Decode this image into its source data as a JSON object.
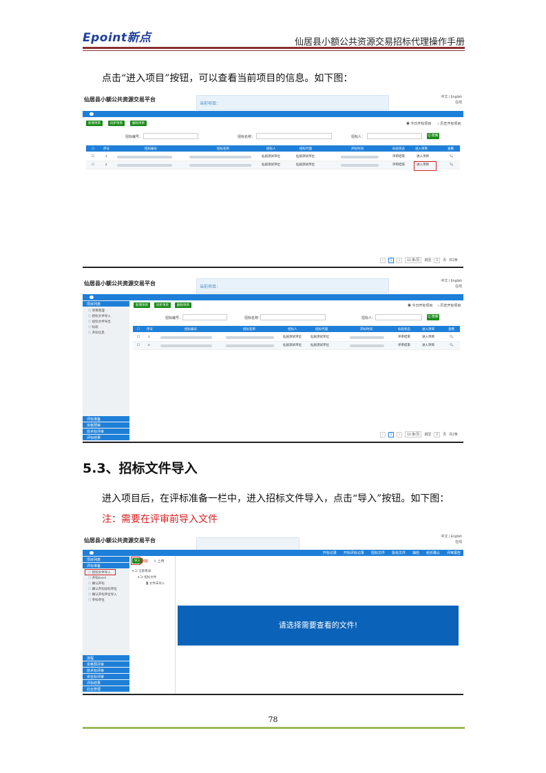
{
  "header": {
    "logo": "Epoint新点",
    "manual_title": "仙居县小额公共资源交易招标代理操作手册"
  },
  "para1": "点击“进入项目”按钮，可以查看当前项目的信息。如下图：",
  "section": {
    "title": "5.3、招标文件导入"
  },
  "para2": "进入项目后，在评标准备一栏中，进入招标文件导入，点击“导入”按钮。如下图：",
  "note": "注：需要在评审前导入文件",
  "page_number": "78",
  "app": {
    "title": "仙居县小额公共资源交易平台",
    "lang": "中文 | English",
    "status": "在线",
    "current_item_label": "当前项目：",
    "btn_new_project": "新增项目",
    "btn_multi_project": "同步项目",
    "btn_delete_project": "删除项目",
    "radio_today": "今日开标项目",
    "radio_all": "历史开标项目",
    "search_code_label": "招标编号：",
    "search_name_label": "招标名称：",
    "search_owner_label": "招标人：",
    "search_btn": "Q 搜索",
    "cols": [
      "序号",
      "招标编号",
      "招标名称",
      "招标人",
      "招标代理",
      "开标时间",
      "标段状态",
      "进入项目",
      "查看"
    ],
    "rows": [
      {
        "num": "1",
        "owner": "仙居测试单位",
        "agent": "仙居测试单位",
        "status": "评审结束",
        "enter": "进入项目"
      },
      {
        "num": "2",
        "owner": "仙居测试单位",
        "agent": "仙居测试单位",
        "status": "评审结束",
        "enter": "进入项目"
      }
    ],
    "pager_size": "10",
    "pager_unit": "条/页",
    "pager_goto": "跳至",
    "pager_page": "1",
    "pager_suffix": "页",
    "pager_total": "共2条"
  },
  "app2": {
    "top_nav": [
      "开标记录",
      "开标评标记录",
      "招标文件",
      "投标文件",
      "抽检",
      "组长确认",
      "评审报告"
    ],
    "side_heads_top": [
      "项目列表",
      "评标准备"
    ],
    "side_items": [
      "项目管理",
      "招标文件导入",
      "招标文件导出",
      "标段",
      "开标信息"
    ],
    "side_heads_bottom": [
      "评标准备",
      "资格预审",
      "技术标评审",
      "评标结果"
    ],
    "side3_items": [
      "招标文件导入",
      "开标Excel",
      "确认开标",
      "确认开标投标单位",
      "确认开标单位导入",
      "参标单位"
    ],
    "side3_bottom": [
      "流程",
      "资格预评审",
      "技术标评审",
      "资信标评审",
      "评标结果",
      "后台管理"
    ],
    "btn_import": "导入",
    "btn_delete": "删除",
    "btn_upload": "上传",
    "tree": [
      "全部目录",
      "招标文件",
      "文件未导入"
    ],
    "viewer_msg": "请选择需要查看的文件!"
  }
}
